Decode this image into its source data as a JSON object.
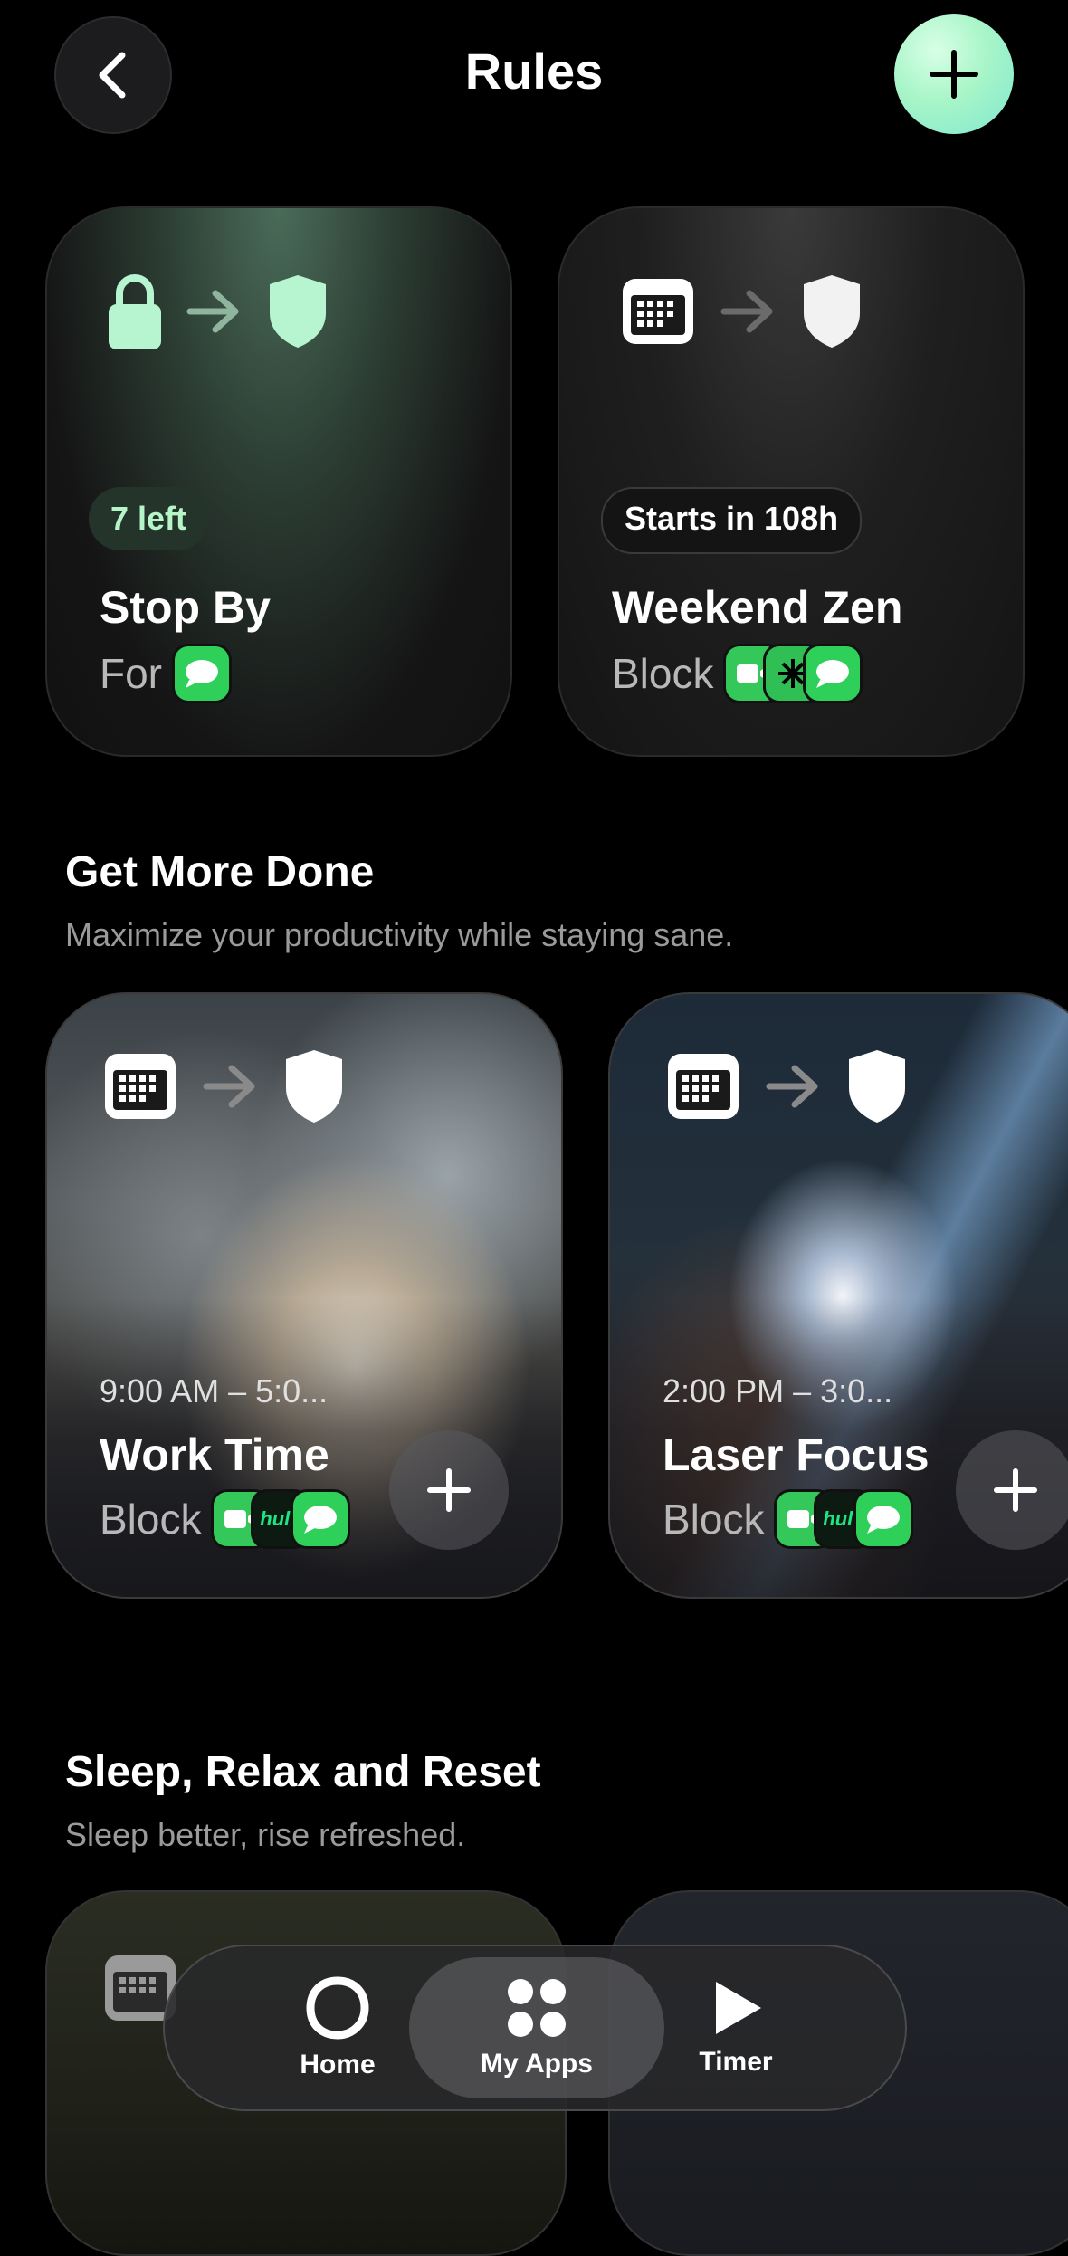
{
  "header": {
    "title": "Rules"
  },
  "rules": [
    {
      "pill": "7 left",
      "name": "Stop By",
      "sub": "For"
    },
    {
      "pill": "Starts in 108h",
      "name": "Weekend Zen",
      "sub": "Block"
    }
  ],
  "sections": [
    {
      "title": "Get More Done",
      "subtitle": "Maximize your productivity while staying sane.",
      "cards": [
        {
          "time": "9:00 AM – 5:0...",
          "name": "Work Time",
          "sub": "Block"
        },
        {
          "time": "2:00 PM – 3:0...",
          "name": "Laser Focus",
          "sub": "Block"
        }
      ]
    },
    {
      "title": "Sleep, Relax and Reset",
      "subtitle": "Sleep better, rise refreshed."
    }
  ],
  "apps": {
    "hulu": "hulu"
  },
  "tabbar": {
    "tabs": [
      {
        "label": "Home",
        "icon": "home-ring-icon"
      },
      {
        "label": "My Apps",
        "icon": "apps-grid-icon"
      },
      {
        "label": "Timer",
        "icon": "play-icon"
      }
    ],
    "active": "My Apps"
  },
  "colors": {
    "accent_green": "#b6f5c8",
    "messages_green": "#2fd05a",
    "background": "#000000"
  }
}
